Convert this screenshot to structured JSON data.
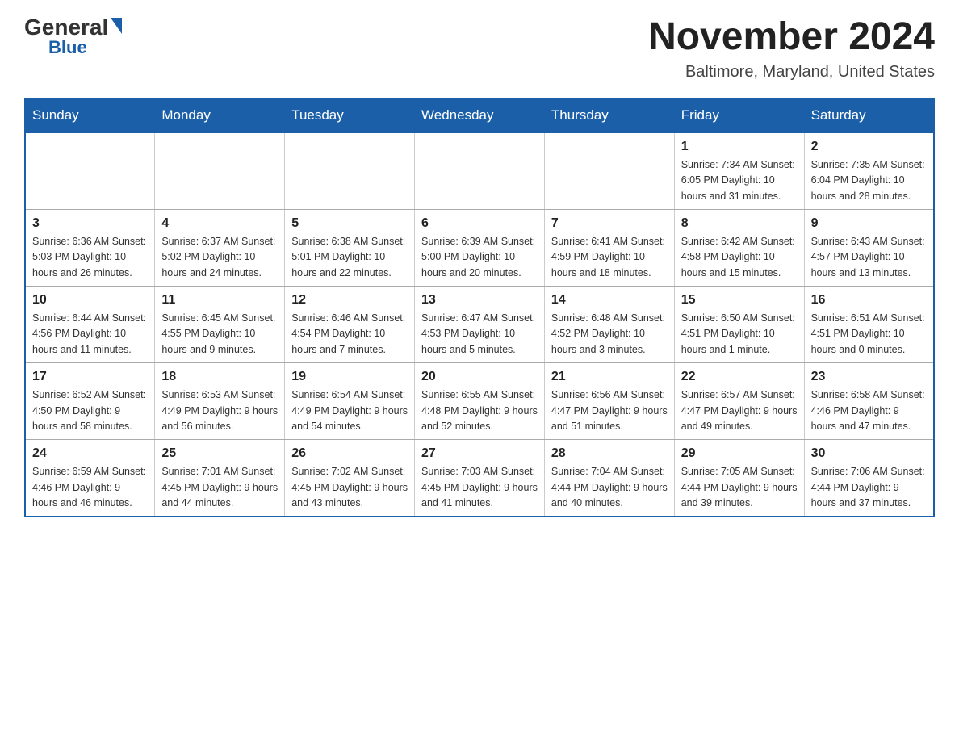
{
  "header": {
    "logo_general": "General",
    "logo_blue": "Blue",
    "month_title": "November 2024",
    "location": "Baltimore, Maryland, United States"
  },
  "calendar": {
    "days_of_week": [
      "Sunday",
      "Monday",
      "Tuesday",
      "Wednesday",
      "Thursday",
      "Friday",
      "Saturday"
    ],
    "weeks": [
      [
        {
          "day": "",
          "info": ""
        },
        {
          "day": "",
          "info": ""
        },
        {
          "day": "",
          "info": ""
        },
        {
          "day": "",
          "info": ""
        },
        {
          "day": "",
          "info": ""
        },
        {
          "day": "1",
          "info": "Sunrise: 7:34 AM\nSunset: 6:05 PM\nDaylight: 10 hours and 31 minutes."
        },
        {
          "day": "2",
          "info": "Sunrise: 7:35 AM\nSunset: 6:04 PM\nDaylight: 10 hours and 28 minutes."
        }
      ],
      [
        {
          "day": "3",
          "info": "Sunrise: 6:36 AM\nSunset: 5:03 PM\nDaylight: 10 hours and 26 minutes."
        },
        {
          "day": "4",
          "info": "Sunrise: 6:37 AM\nSunset: 5:02 PM\nDaylight: 10 hours and 24 minutes."
        },
        {
          "day": "5",
          "info": "Sunrise: 6:38 AM\nSunset: 5:01 PM\nDaylight: 10 hours and 22 minutes."
        },
        {
          "day": "6",
          "info": "Sunrise: 6:39 AM\nSunset: 5:00 PM\nDaylight: 10 hours and 20 minutes."
        },
        {
          "day": "7",
          "info": "Sunrise: 6:41 AM\nSunset: 4:59 PM\nDaylight: 10 hours and 18 minutes."
        },
        {
          "day": "8",
          "info": "Sunrise: 6:42 AM\nSunset: 4:58 PM\nDaylight: 10 hours and 15 minutes."
        },
        {
          "day": "9",
          "info": "Sunrise: 6:43 AM\nSunset: 4:57 PM\nDaylight: 10 hours and 13 minutes."
        }
      ],
      [
        {
          "day": "10",
          "info": "Sunrise: 6:44 AM\nSunset: 4:56 PM\nDaylight: 10 hours and 11 minutes."
        },
        {
          "day": "11",
          "info": "Sunrise: 6:45 AM\nSunset: 4:55 PM\nDaylight: 10 hours and 9 minutes."
        },
        {
          "day": "12",
          "info": "Sunrise: 6:46 AM\nSunset: 4:54 PM\nDaylight: 10 hours and 7 minutes."
        },
        {
          "day": "13",
          "info": "Sunrise: 6:47 AM\nSunset: 4:53 PM\nDaylight: 10 hours and 5 minutes."
        },
        {
          "day": "14",
          "info": "Sunrise: 6:48 AM\nSunset: 4:52 PM\nDaylight: 10 hours and 3 minutes."
        },
        {
          "day": "15",
          "info": "Sunrise: 6:50 AM\nSunset: 4:51 PM\nDaylight: 10 hours and 1 minute."
        },
        {
          "day": "16",
          "info": "Sunrise: 6:51 AM\nSunset: 4:51 PM\nDaylight: 10 hours and 0 minutes."
        }
      ],
      [
        {
          "day": "17",
          "info": "Sunrise: 6:52 AM\nSunset: 4:50 PM\nDaylight: 9 hours and 58 minutes."
        },
        {
          "day": "18",
          "info": "Sunrise: 6:53 AM\nSunset: 4:49 PM\nDaylight: 9 hours and 56 minutes."
        },
        {
          "day": "19",
          "info": "Sunrise: 6:54 AM\nSunset: 4:49 PM\nDaylight: 9 hours and 54 minutes."
        },
        {
          "day": "20",
          "info": "Sunrise: 6:55 AM\nSunset: 4:48 PM\nDaylight: 9 hours and 52 minutes."
        },
        {
          "day": "21",
          "info": "Sunrise: 6:56 AM\nSunset: 4:47 PM\nDaylight: 9 hours and 51 minutes."
        },
        {
          "day": "22",
          "info": "Sunrise: 6:57 AM\nSunset: 4:47 PM\nDaylight: 9 hours and 49 minutes."
        },
        {
          "day": "23",
          "info": "Sunrise: 6:58 AM\nSunset: 4:46 PM\nDaylight: 9 hours and 47 minutes."
        }
      ],
      [
        {
          "day": "24",
          "info": "Sunrise: 6:59 AM\nSunset: 4:46 PM\nDaylight: 9 hours and 46 minutes."
        },
        {
          "day": "25",
          "info": "Sunrise: 7:01 AM\nSunset: 4:45 PM\nDaylight: 9 hours and 44 minutes."
        },
        {
          "day": "26",
          "info": "Sunrise: 7:02 AM\nSunset: 4:45 PM\nDaylight: 9 hours and 43 minutes."
        },
        {
          "day": "27",
          "info": "Sunrise: 7:03 AM\nSunset: 4:45 PM\nDaylight: 9 hours and 41 minutes."
        },
        {
          "day": "28",
          "info": "Sunrise: 7:04 AM\nSunset: 4:44 PM\nDaylight: 9 hours and 40 minutes."
        },
        {
          "day": "29",
          "info": "Sunrise: 7:05 AM\nSunset: 4:44 PM\nDaylight: 9 hours and 39 minutes."
        },
        {
          "day": "30",
          "info": "Sunrise: 7:06 AM\nSunset: 4:44 PM\nDaylight: 9 hours and 37 minutes."
        }
      ]
    ]
  }
}
